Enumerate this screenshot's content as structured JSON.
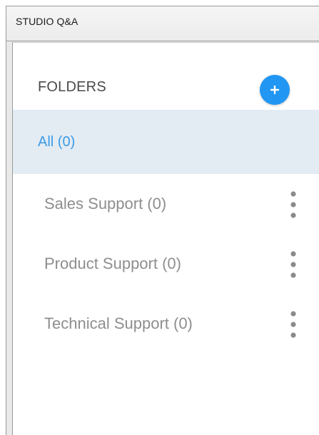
{
  "window": {
    "title": "STUDIO Q&A"
  },
  "folders": {
    "title": "FOLDERS",
    "add_icon": "plus-icon",
    "accent_color": "#2196f3",
    "all_item": {
      "label": "All (0)",
      "color": "#3a9be6"
    },
    "items": [
      {
        "label": "Sales Support (0)",
        "menu_icon": "more-vertical-icon"
      },
      {
        "label": "Product Support (0)",
        "menu_icon": "more-vertical-icon"
      },
      {
        "label": "Technical Support (0)",
        "menu_icon": "more-vertical-icon"
      }
    ]
  }
}
